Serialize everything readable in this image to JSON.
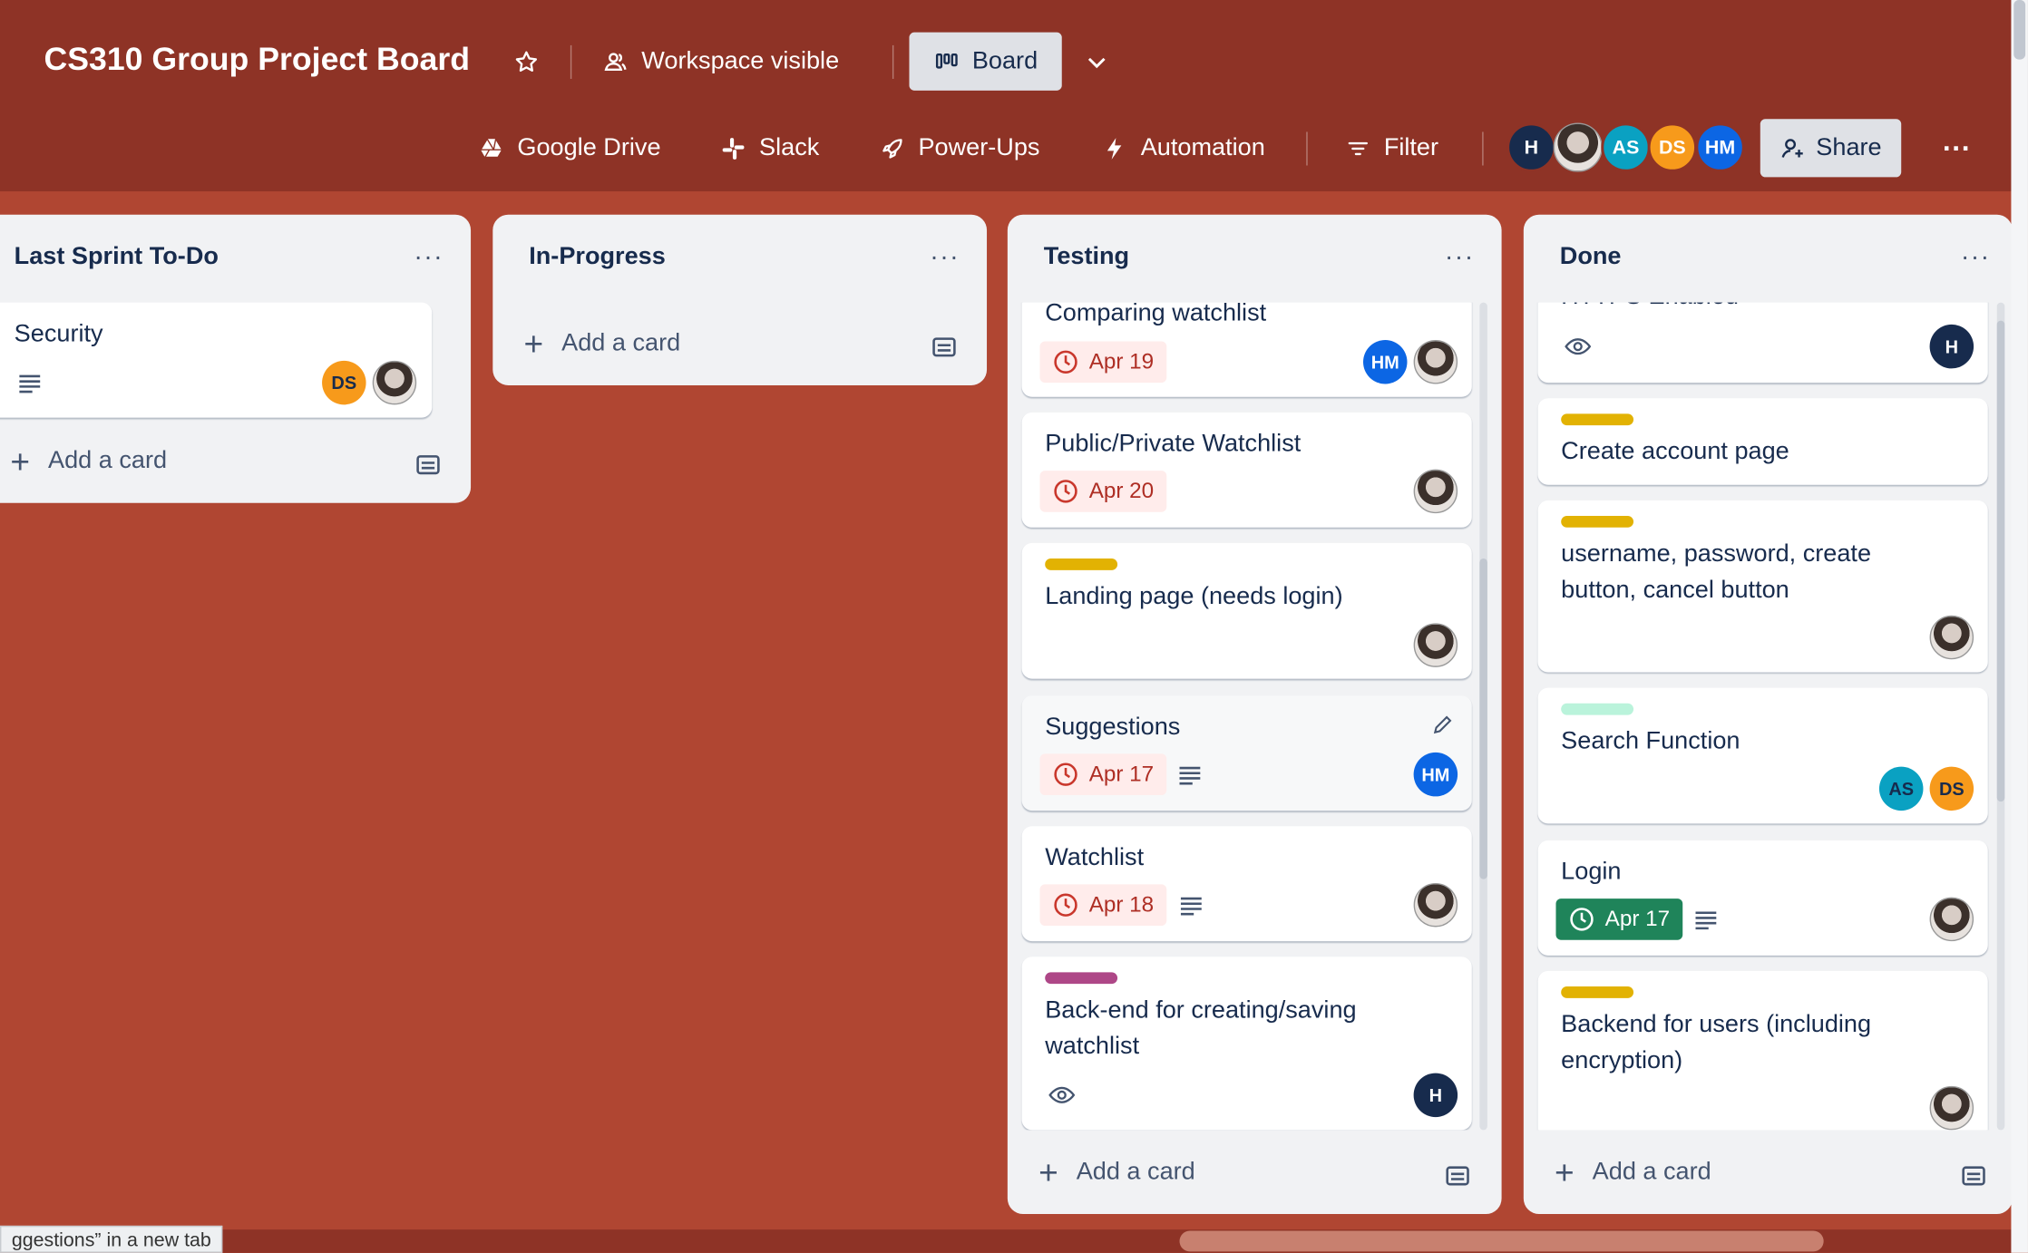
{
  "header": {
    "board_title": "CS310 Group Project Board",
    "visibility_label": "Workspace visible",
    "view_label": "Board",
    "powerups": {
      "google_drive": "Google Drive",
      "slack": "Slack",
      "power_ups": "Power-Ups",
      "automation": "Automation",
      "filter": "Filter"
    },
    "members": [
      {
        "initials": "H",
        "color": "#172b4d"
      },
      {
        "initials": "",
        "color": "#ddd"
      },
      {
        "initials": "AS",
        "color": "#0aa1c2"
      },
      {
        "initials": "DS",
        "color": "#f79a1b"
      },
      {
        "initials": "HM",
        "color": "#0c66e4"
      }
    ],
    "share_label": "Share",
    "more_label": "···"
  },
  "lists": [
    {
      "title": "Last Sprint To-Do",
      "menu": "···",
      "add_card": "Add a card",
      "cards": [
        {
          "title": "Security",
          "members": [
            "DS",
            "photo"
          ]
        }
      ]
    },
    {
      "title": "In-Progress",
      "menu": "···",
      "add_card": "Add a card",
      "cards": []
    },
    {
      "title": "Testing",
      "menu": "···",
      "add_card": "Add a card",
      "cards": [
        {
          "title": "Comparing watchlist",
          "due": "Apr 19",
          "members": [
            "HM",
            "photo"
          ]
        },
        {
          "title": "Public/Private Watchlist",
          "due": "Apr 20",
          "members": [
            "photo"
          ]
        },
        {
          "title": "Landing page (needs login)",
          "label_color": "#e2b203",
          "members": [
            "photo"
          ]
        },
        {
          "title": "Suggestions",
          "due": "Apr 17",
          "members": [
            "HM"
          ]
        },
        {
          "title": "Watchlist",
          "due": "Apr 18",
          "members": [
            "photo"
          ]
        },
        {
          "title": "Back-end for creating/saving watchlist",
          "label_color": "#ae4787",
          "members": [
            "H"
          ]
        }
      ]
    },
    {
      "title": "Done",
      "menu": "···",
      "add_card": "Add a card",
      "cards": [
        {
          "title": "HTTPS Enabled",
          "members": [
            "H"
          ]
        },
        {
          "title": "Create account page",
          "label_color": "#e2b203"
        },
        {
          "title": "username, password, create button, cancel button",
          "label_color": "#e2b203",
          "members": [
            "photo"
          ]
        },
        {
          "title": "Search Function",
          "label_color": "#baf3db",
          "members": [
            "AS",
            "DS"
          ]
        },
        {
          "title": "Login",
          "due": "Apr 17",
          "due_status": "complete",
          "members": [
            "photo"
          ]
        },
        {
          "title": "Backend for users (including encryption)",
          "label_color": "#e2b203",
          "members": [
            "photo"
          ]
        }
      ]
    }
  ],
  "status_bar": {
    "link_hint": "ggestions” in a new tab"
  },
  "colors": {
    "board_bg": "#b04632",
    "header_bg": "#8e3326",
    "due_overdue": "#ae2e24",
    "due_complete": "#1f845a"
  }
}
